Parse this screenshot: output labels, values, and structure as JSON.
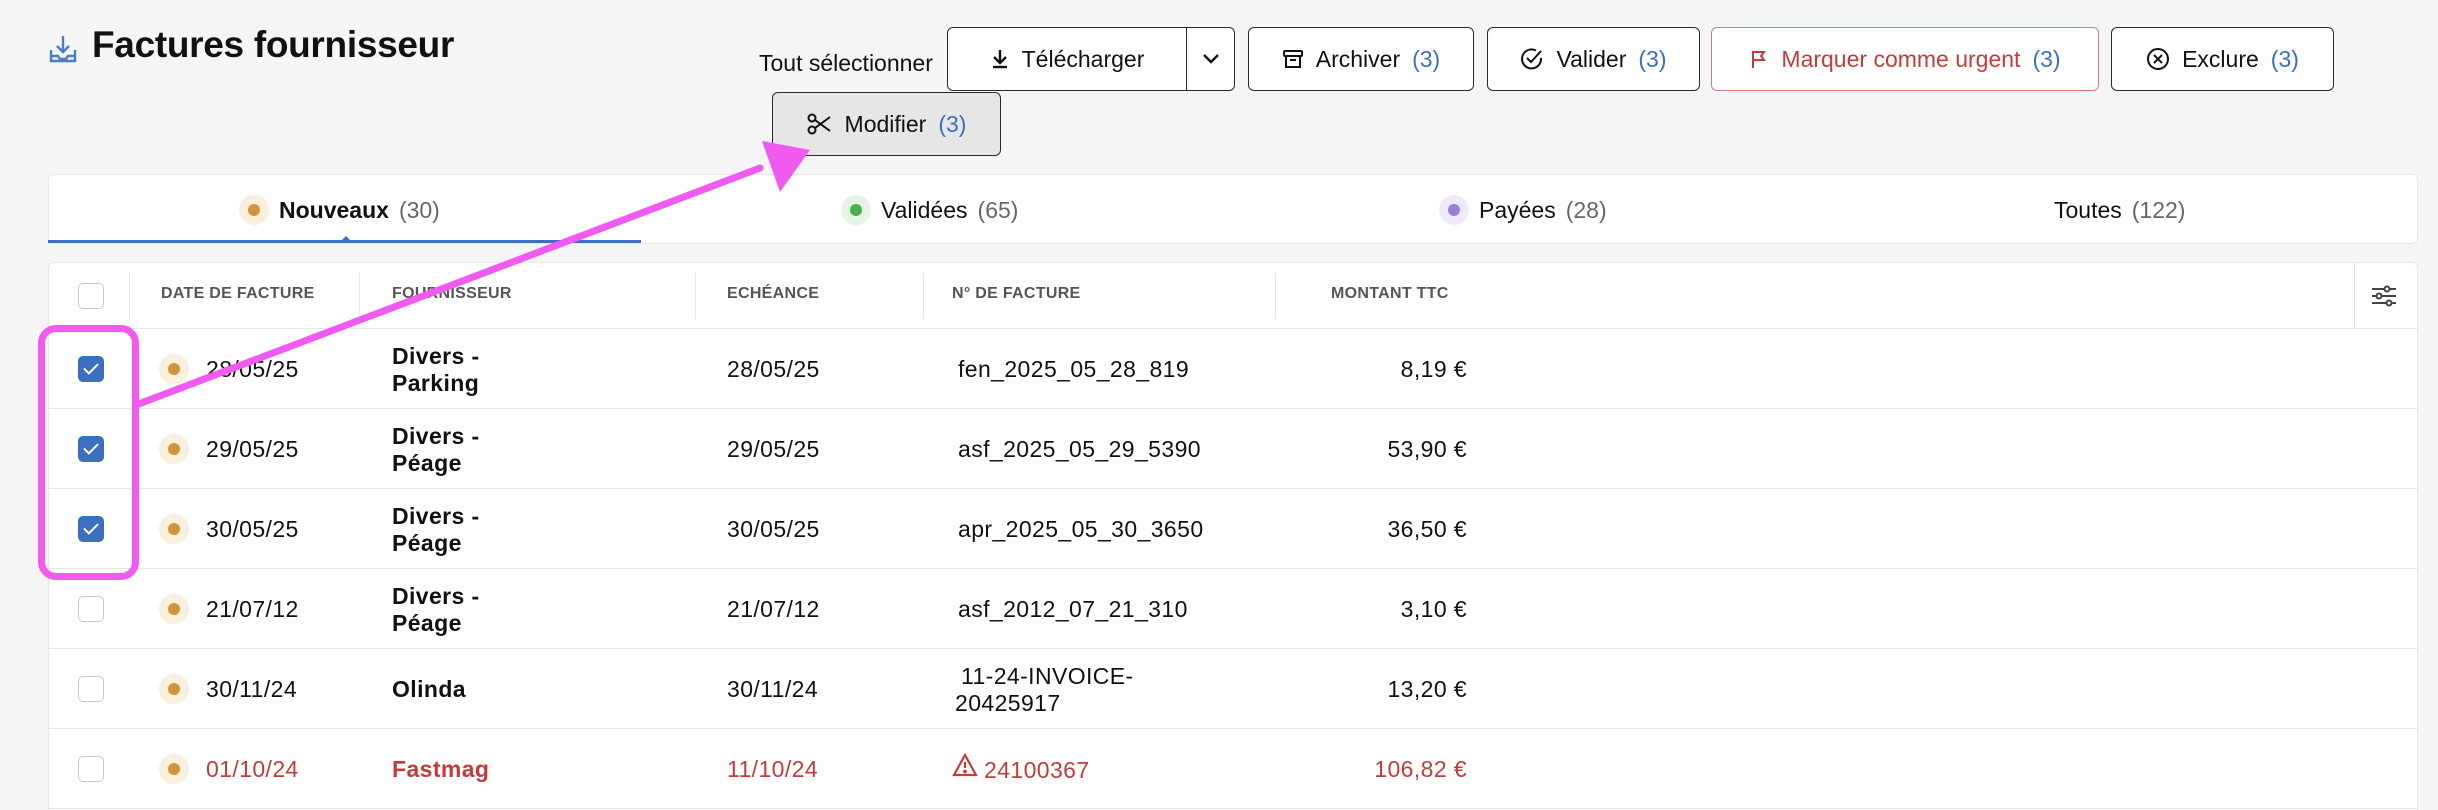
{
  "header": {
    "title": "Factures fournisseur",
    "select_all": "Tout sélectionner"
  },
  "toolbar": {
    "download_label": "Télécharger",
    "archive_label": "Archiver",
    "archive_count": "(3)",
    "validate_label": "Valider",
    "validate_count": "(3)",
    "urgent_label": "Marquer comme urgent",
    "urgent_count": "(3)",
    "exclude_label": "Exclure",
    "exclude_count": "(3)",
    "modify_label": "Modifier",
    "modify_count": "(3)"
  },
  "tabs": [
    {
      "label": "Nouveaux",
      "count": "(30)",
      "dot_color": "#d4933a",
      "dot_bg": "#faeedd"
    },
    {
      "label": "Validées",
      "count": "(65)",
      "dot_color": "#4caf50",
      "dot_bg": "#e6f4e6"
    },
    {
      "label": "Payées",
      "count": "(28)",
      "dot_color": "#9b7fd6",
      "dot_bg": "#efeafa"
    },
    {
      "label": "Toutes",
      "count": "(122)"
    }
  ],
  "table": {
    "columns": [
      "DATE DE FACTURE",
      "FOURNISSEUR",
      "ECHÉANCE",
      "N° DE FACTURE",
      "MONTANT TTC"
    ],
    "rows": [
      {
        "checked": true,
        "date": "28/05/25",
        "supplier_1": "Divers -",
        "supplier_2": "Parking",
        "due": "28/05/25",
        "invoice_1": "fen_2025_05_28_819",
        "invoice_2": "",
        "amount": "8,19 €",
        "alert": false
      },
      {
        "checked": true,
        "date": "29/05/25",
        "supplier_1": "Divers -",
        "supplier_2": "Péage",
        "due": "29/05/25",
        "invoice_1": "asf_2025_05_29_5390",
        "invoice_2": "",
        "amount": "53,90 €",
        "alert": false
      },
      {
        "checked": true,
        "date": "30/05/25",
        "supplier_1": "Divers -",
        "supplier_2": "Péage",
        "due": "30/05/25",
        "invoice_1": "apr_2025_05_30_3650",
        "invoice_2": "",
        "amount": "36,50 €",
        "alert": false
      },
      {
        "checked": false,
        "date": "21/07/12",
        "supplier_1": "Divers -",
        "supplier_2": "Péage",
        "due": "21/07/12",
        "invoice_1": "asf_2012_07_21_310",
        "invoice_2": "",
        "amount": "3,10 €",
        "alert": false
      },
      {
        "checked": false,
        "date": "30/11/24",
        "supplier_1": "Olinda",
        "supplier_2": "",
        "due": "30/11/24",
        "invoice_1": "11-24-INVOICE-",
        "invoice_2": "20425917",
        "amount": "13,20 €",
        "alert": false
      },
      {
        "checked": false,
        "date": "01/10/24",
        "supplier_1": "Fastmag",
        "supplier_2": "",
        "due": "11/10/24",
        "invoice_1": "24100367",
        "invoice_2": "",
        "amount": "106,82 €",
        "alert": true
      }
    ]
  },
  "colors": {
    "accent": "#3b6fc2",
    "urgent": "#c43b3b",
    "annotation": "#f05af0"
  }
}
